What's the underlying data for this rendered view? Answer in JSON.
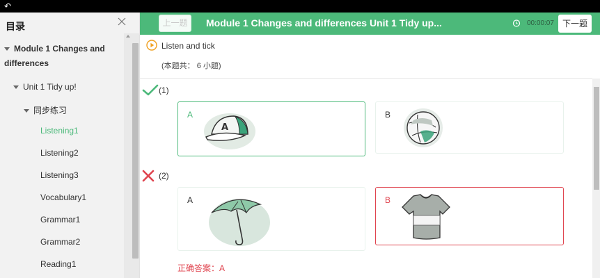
{
  "window": {
    "back_icon": "back-arrow-icon"
  },
  "sidebar": {
    "title": "目录",
    "close_icon": "close-icon",
    "tree": [
      {
        "label": "Module 1 Changes and differences",
        "level": 0,
        "expanded": true
      },
      {
        "label": "Unit 1 Tidy up!",
        "level": 1,
        "expanded": true
      },
      {
        "label": "同步练习",
        "level": 2,
        "expanded": true
      },
      {
        "label": "Listening1",
        "level": 3,
        "active": true
      },
      {
        "label": "Listening2",
        "level": 3
      },
      {
        "label": "Listening3",
        "level": 3
      },
      {
        "label": "Vocabulary1",
        "level": 3
      },
      {
        "label": "Grammar1",
        "level": 3
      },
      {
        "label": "Grammar2",
        "level": 3
      },
      {
        "label": "Reading1",
        "level": 3
      }
    ]
  },
  "header": {
    "prev_label": "上一题",
    "title": "Module 1 Changes and differences Unit 1 Tidy up...",
    "timer": "00:00:07",
    "next_label": "下一题",
    "accent_color": "#4cb97a"
  },
  "main": {
    "instruction": "Listen and tick",
    "count": "(本题共： 6 小题)",
    "questions": [
      {
        "number": "(1)",
        "result": "correct",
        "options": [
          {
            "letter": "A",
            "image": "baseball-cap",
            "state": "selected-correct"
          },
          {
            "letter": "B",
            "image": "beach-ball",
            "state": "normal"
          }
        ]
      },
      {
        "number": "(2)",
        "result": "wrong",
        "options": [
          {
            "letter": "A",
            "image": "umbrella",
            "state": "normal"
          },
          {
            "letter": "B",
            "image": "t-shirt",
            "state": "selected-wrong"
          }
        ],
        "answer_text": "正确答案：A"
      }
    ],
    "colors": {
      "correct": "#4cb97a",
      "wrong": "#e0444f"
    }
  }
}
